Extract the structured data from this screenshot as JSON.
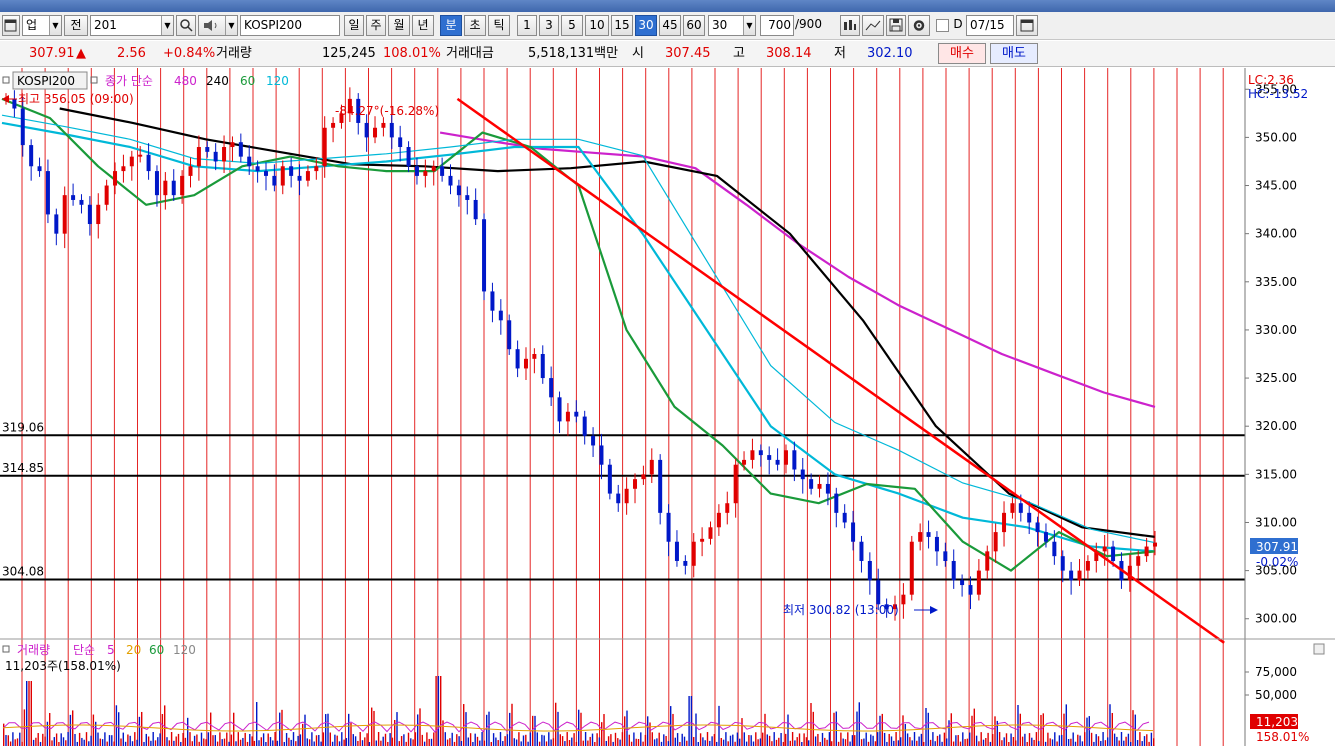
{
  "toolbar": {
    "market": "업",
    "prev_label": "전",
    "code": "201",
    "name": "KOSPI200",
    "periods": [
      "일",
      "주",
      "월",
      "년",
      "분",
      "초",
      "틱"
    ],
    "active_period": "분",
    "minutes": [
      "1",
      "3",
      "5",
      "10",
      "15",
      "30",
      "45",
      "60"
    ],
    "active_minute": "30",
    "minute_select": "30",
    "count_value": "700",
    "count_total": "/900",
    "d_label": "D",
    "date": "07/15"
  },
  "quote": {
    "price": "307.91",
    "change_arrow": "▲",
    "change": "2.56",
    "change_pct": "+0.84%",
    "volume_label": "거래량",
    "volume": "125,245",
    "volume_pct": "108.01%",
    "amount_label": "거래대금",
    "amount": "5,518,131백만",
    "open_label": "시",
    "open": "307.45",
    "high_label": "고",
    "high": "308.14",
    "low_label": "저",
    "low": "302.10",
    "buy_label": "매수",
    "sell_label": "매도"
  },
  "colors": {
    "up": "#e00000",
    "down": "#0018c8",
    "ma5": "#1a9a3a",
    "ma60": "#00b8d8",
    "ma240": "#000000",
    "ma480": "#cc22cc",
    "trendline": "#ff0000",
    "price_tag": "#2f6fd0"
  },
  "price_panel": {
    "legend_name": "KOSPI200",
    "legend_ma_label": "종가 단순",
    "legend_periods": [
      "480",
      "240",
      "60",
      "120"
    ],
    "high_annotation": "최고 356.05 (09:00)",
    "low_annotation": "최저 300.82 (13:00)",
    "angle_annotation": "-84.27°(-16.28%)",
    "lc_label": "LC:2.36",
    "hc_label": "HC:-13.52",
    "current_price_tag": "307.91",
    "current_change_tag": "-0.02%"
  },
  "volume_panel": {
    "legend_name": "거래량",
    "legend_ma_label": "단순",
    "legend_periods": [
      "5",
      "20",
      "60",
      "120"
    ],
    "last_volume": "11,203주(158.01%)",
    "tag_value": "11,203",
    "tag_pct": "158.01%"
  },
  "chart_data": {
    "type": "candlestick",
    "price_axis": {
      "ylim": [
        298,
        357
      ],
      "ticks": [
        "355.00",
        "350.00",
        "345.00",
        "340.00",
        "335.00",
        "330.00",
        "325.00",
        "320.00",
        "315.00",
        "310.00",
        "305.00",
        "300.00"
      ]
    },
    "volume_axis": {
      "ticks": [
        "75,000",
        "50,000"
      ]
    },
    "horizontal_levels": [
      {
        "value": 319.06,
        "label": "319.06"
      },
      {
        "value": 314.85,
        "label": "314.85"
      },
      {
        "value": 304.08,
        "label": "304.08"
      }
    ],
    "trendline": {
      "start": {
        "bar": 0.395,
        "price": 354
      },
      "end": {
        "bar": 1.06,
        "price": 297.5
      }
    },
    "closes": [
      354,
      353,
      349.2,
      347,
      346.5,
      342,
      340,
      344,
      343.5,
      343,
      341,
      343,
      345,
      346.5,
      347,
      348,
      348.2,
      346.5,
      344,
      345.5,
      344,
      346,
      347,
      349,
      348.5,
      347.5,
      349,
      349.5,
      348,
      347,
      346.5,
      346,
      345,
      347,
      346,
      345.5,
      346.5,
      347,
      351,
      351.5,
      352.5,
      354,
      351.5,
      350,
      351,
      351.5,
      350,
      349,
      347,
      346,
      346.5,
      347,
      346,
      345,
      344,
      343.5,
      341.5,
      334,
      332,
      331,
      328,
      326,
      327,
      327.5,
      325,
      323,
      320.5,
      321.5,
      321,
      319,
      318,
      316,
      313,
      312,
      313.5,
      314.5,
      315,
      316.5,
      311,
      308,
      306,
      305.5,
      308,
      308.3,
      309.5,
      311,
      312,
      316,
      316.5,
      317.5,
      317,
      316.5,
      316,
      317.5,
      315.5,
      314.5,
      313.5,
      314,
      313,
      311,
      310,
      308,
      306,
      304,
      301.5,
      301,
      301.5,
      302.5,
      308,
      309,
      308.5,
      307,
      306,
      304,
      303.5,
      302.5,
      305,
      307,
      309,
      311,
      312,
      311,
      310,
      309,
      308,
      306.5,
      305,
      304,
      305,
      306,
      307,
      307.5,
      306,
      304,
      305.5,
      306.5,
      307.5,
      307.91
    ],
    "ma_series": [
      {
        "name": "480",
        "values": [
          350.5,
          349.6,
          348.8,
          348.4,
          348,
          346.8,
          343,
          339,
          335.5,
          332.5,
          330,
          327.5,
          325.5,
          323.5,
          322
        ]
      },
      {
        "name": "240",
        "values": [
          353,
          351.5,
          349.8,
          348.5,
          347.2,
          347,
          346.5,
          346.8,
          347.5,
          346,
          340,
          331,
          320,
          313,
          309.5,
          308.5
        ]
      },
      {
        "name": "60",
        "values": [
          351.5,
          350.3,
          349,
          347,
          346.5,
          347,
          347.5,
          348.2,
          349,
          349,
          340,
          330,
          320,
          315,
          313,
          310.5,
          309.5,
          307.5,
          307
        ]
      },
      {
        "name": "5",
        "values": [
          354,
          352,
          347,
          343,
          344,
          347,
          348,
          347,
          346.5,
          346.5,
          350.5,
          349,
          345,
          330,
          322,
          318,
          313,
          312,
          314,
          313.5,
          308,
          305,
          309,
          306.5,
          307
        ]
      }
    ]
  }
}
